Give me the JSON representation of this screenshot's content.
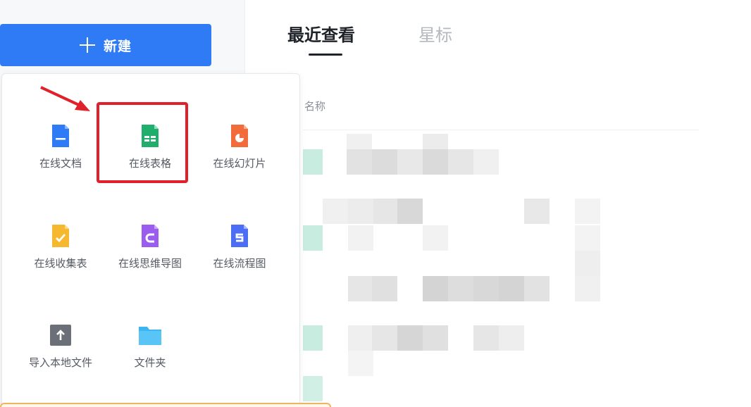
{
  "sidebar": {
    "new_button_label": "新建"
  },
  "tabs": [
    {
      "label": "最近查看",
      "active": true
    },
    {
      "label": "星标",
      "active": false
    }
  ],
  "list": {
    "column_name": "名称"
  },
  "new_menu": {
    "items": [
      {
        "label": "在线文档",
        "icon": "doc-icon",
        "color": "#2f7bf5"
      },
      {
        "label": "在线表格",
        "icon": "sheet-icon",
        "color": "#1fae6b"
      },
      {
        "label": "在线幻灯片",
        "icon": "slides-icon",
        "color": "#f26b3a"
      },
      {
        "label": "在线收集表",
        "icon": "form-icon",
        "color": "#f5b82e"
      },
      {
        "label": "在线思维导图",
        "icon": "mindmap-icon",
        "color": "#9b5cf0"
      },
      {
        "label": "在线流程图",
        "icon": "flowchart-icon",
        "color": "#4b6ef5"
      },
      {
        "label": "导入本地文件",
        "icon": "upload-icon",
        "color": "#6b6f77"
      },
      {
        "label": "文件夹",
        "icon": "folder-icon",
        "color": "#3cb6f2"
      }
    ]
  },
  "colors": {
    "accent": "#2f7bf5",
    "highlight": "#e0202a"
  }
}
